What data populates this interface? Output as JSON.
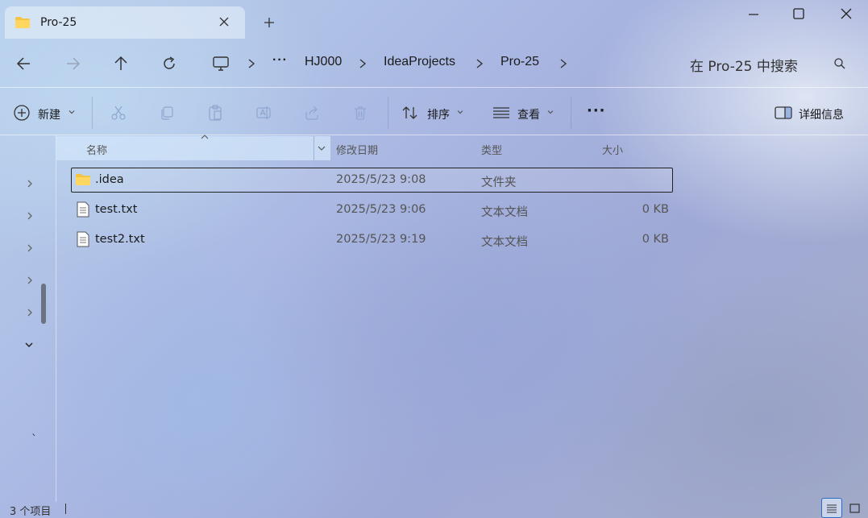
{
  "window": {
    "tab_title": "Pro-25",
    "new_tab": "+"
  },
  "nav": {
    "breadcrumb": [
      "HJ000",
      "IdeaProjects",
      "Pro-25"
    ],
    "overflow": "···",
    "search_placeholder": "在 Pro-25 中搜索"
  },
  "toolbar": {
    "new_label": "新建",
    "sort_label": "排序",
    "view_label": "查看",
    "more": "···",
    "details_label": "详细信息"
  },
  "columns": {
    "name": "名称",
    "modified": "修改日期",
    "type": "类型",
    "size": "大小"
  },
  "files": [
    {
      "name": ".idea",
      "modified": "2025/5/23 9:08",
      "type": "文件夹",
      "size": "",
      "icon": "folder-icon",
      "selected": true
    },
    {
      "name": "test.txt",
      "modified": "2025/5/23 9:06",
      "type": "文本文档",
      "size": "0 KB",
      "icon": "text-file-icon",
      "selected": false
    },
    {
      "name": "test2.txt",
      "modified": "2025/5/23 9:19",
      "type": "文本文档",
      "size": "0 KB",
      "icon": "text-file-icon",
      "selected": false
    }
  ],
  "left_pane": {
    "stray_mark": "`"
  },
  "status": {
    "item_count": "3 个项目"
  },
  "colors": {
    "folder": "#f4c542",
    "selection_border": "#222222",
    "accent": "#2b6cc4"
  }
}
